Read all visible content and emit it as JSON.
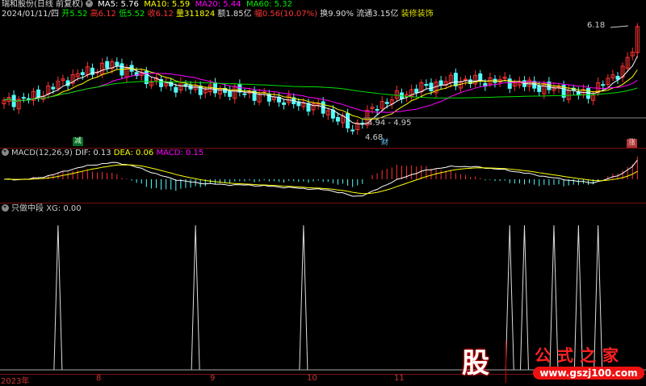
{
  "header": {
    "stock": "瑞和股份(日线 前复权)",
    "ma5": "MA5: 5.76",
    "ma10": "MA10: 5.59",
    "ma20": "MA20: 5.44",
    "ma60": "MA60: 5.32",
    "date": "2024/01/11/四",
    "open_l": "开",
    "open": "5.52",
    "high_l": "高",
    "high": "6.12",
    "low_l": "低",
    "low": "5.52",
    "close_l": "收",
    "close": "6.12",
    "vol_l": "量",
    "vol": "311824",
    "amt": "额1.85亿",
    "chg_l": "幅",
    "chg": "0.56(10.07%)",
    "turn": "换9.90%",
    "float": "流通3.15亿",
    "industry": "装修装饰"
  },
  "price_chart": {
    "max_label": "6.18",
    "min_label": "4.68",
    "range_label": "4.94 - 4.95",
    "tag_reduce": "减",
    "tag_fin": "财",
    "tag_limit": "涨",
    "keypoints": [
      [
        0,
        5.15
      ],
      [
        6,
        5.22
      ],
      [
        14,
        5.5
      ],
      [
        22,
        5.66
      ],
      [
        32,
        5.39
      ],
      [
        40,
        5.33
      ],
      [
        49,
        5.28
      ],
      [
        57,
        5.17
      ],
      [
        65,
        5.06
      ],
      [
        71,
        4.79
      ],
      [
        76,
        5.11
      ],
      [
        84,
        5.33
      ],
      [
        91,
        5.44
      ],
      [
        101,
        5.44
      ],
      [
        111,
        5.34
      ],
      [
        119,
        5.25
      ],
      [
        124,
        5.5
      ],
      [
        126,
        5.6
      ],
      [
        128,
        5.85
      ],
      [
        129,
        6.12
      ]
    ]
  },
  "macd": {
    "label": "MACD(12,26,9)",
    "dif": "DIF: 0.13",
    "dea": "DEA: 0.06",
    "macd": "MACD: 0.15"
  },
  "xg": {
    "label": "只做中段",
    "value": "XG: 0.00",
    "signals": [
      11,
      39,
      61,
      103,
      106,
      112,
      117,
      121
    ]
  },
  "axis": {
    "labels": [
      "2023年",
      "8",
      "9",
      "10",
      "11"
    ]
  },
  "watermark": {
    "logo": "股",
    "name": "公式之家",
    "url": "www.gszj100.com"
  },
  "colors": {
    "up": "#ff3232",
    "down": "#54fcfc",
    "ma5": "#ffffff",
    "ma10": "#ffff00",
    "ma20": "#ff00ff",
    "ma60": "#00e000"
  }
}
